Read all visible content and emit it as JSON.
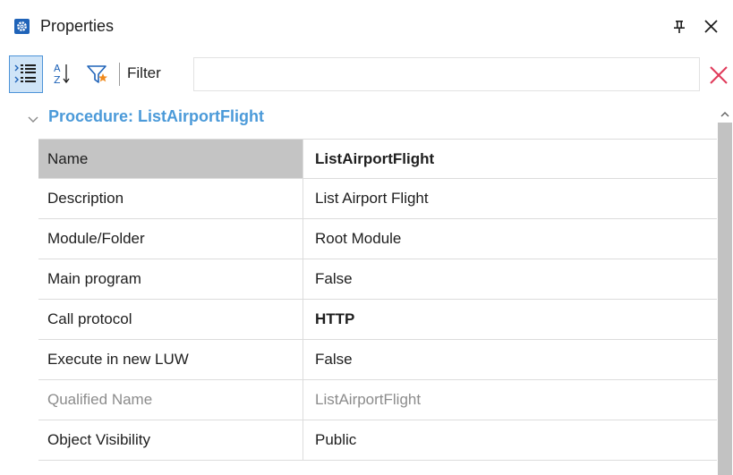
{
  "window": {
    "title": "Properties"
  },
  "toolbar": {
    "filter_label": "Filter",
    "filter_value": "",
    "filter_placeholder": ""
  },
  "icons": {
    "panel": "properties-gear-icon",
    "pin": "pin-icon",
    "close": "close-icon",
    "categorized": "categorized-view-icon",
    "alphabetical": "sort-alphabetical-icon",
    "filter": "filter-icon",
    "clear_filter": "clear-filter-icon",
    "category_toggle": "chevron-down-icon"
  },
  "colors": {
    "accent_blue": "#1f63b8",
    "category_text": "#4b9ad9",
    "selected_row": "#c4c4c4",
    "clear_filter": "#e03a5a",
    "disabled_text": "#8c8c8c"
  },
  "category": {
    "label": "Procedure: ListAirportFlight"
  },
  "properties": [
    {
      "name": "Name",
      "value": "ListAirportFlight"
    },
    {
      "name": "Description",
      "value": "List Airport Flight"
    },
    {
      "name": "Module/Folder",
      "value": "Root Module"
    },
    {
      "name": "Main program",
      "value": "False"
    },
    {
      "name": "Call protocol",
      "value": "HTTP"
    },
    {
      "name": "Execute in new LUW",
      "value": "False"
    },
    {
      "name": "Qualified Name",
      "value": "ListAirportFlight"
    },
    {
      "name": "Object Visibility",
      "value": "Public"
    }
  ]
}
